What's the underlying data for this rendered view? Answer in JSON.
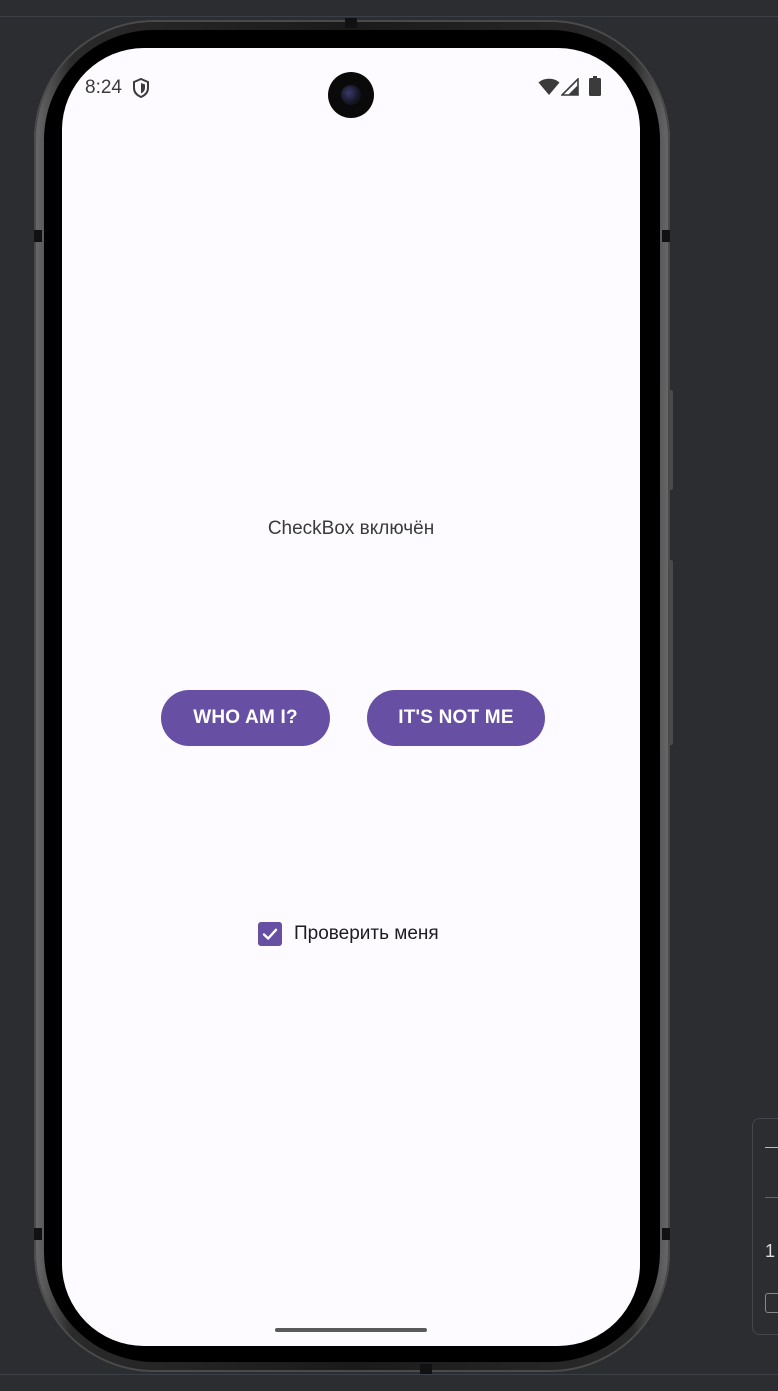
{
  "status_bar": {
    "time": "8:24",
    "icons": [
      "shield-icon",
      "wifi-icon",
      "signal-icon",
      "battery-icon"
    ]
  },
  "app": {
    "status_text": "CheckBox включён",
    "buttons": {
      "who_am_i": "WHO AM I?",
      "its_not_me": "IT'S NOT ME"
    },
    "checkbox": {
      "label": "Проверить меня",
      "checked": true
    }
  },
  "side_panel": {
    "number": "1"
  },
  "colors": {
    "accent": "#6750a4",
    "screen_background": "#fdfbff",
    "ide_background": "#2b2d31"
  }
}
